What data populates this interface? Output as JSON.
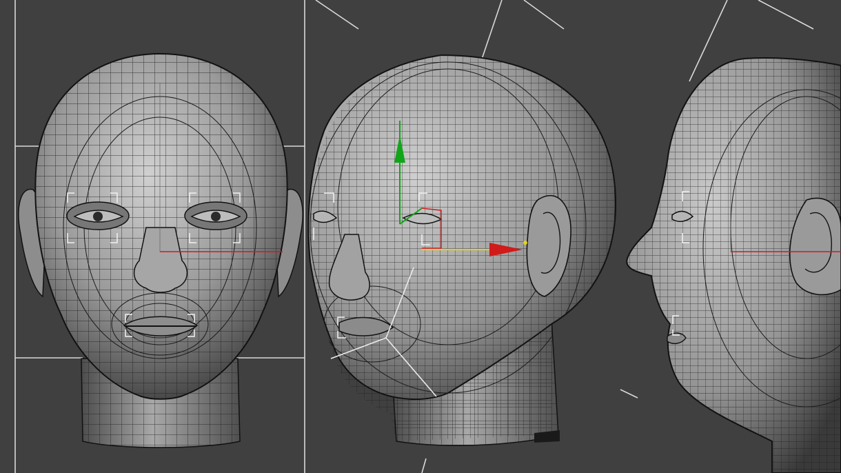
{
  "viewports": [
    {
      "view": "front",
      "object": "head-mesh",
      "gizmo": "transform-axis-x"
    },
    {
      "view": "perspective",
      "object": "head-mesh",
      "gizmo": "move-gizmo-xyz"
    },
    {
      "view": "side",
      "object": "head-mesh",
      "gizmo": "transform-axis-x"
    }
  ],
  "colors": {
    "background": "#404040",
    "mesh_light": "#b9b9b9",
    "mesh_dark": "#2a2a2a",
    "wire": "#1c1c1c",
    "guide": "#e8e8e8",
    "axis_x": "#d11a1a",
    "axis_y": "#12a51a",
    "axis_z_highlight": "#e6d21a"
  }
}
